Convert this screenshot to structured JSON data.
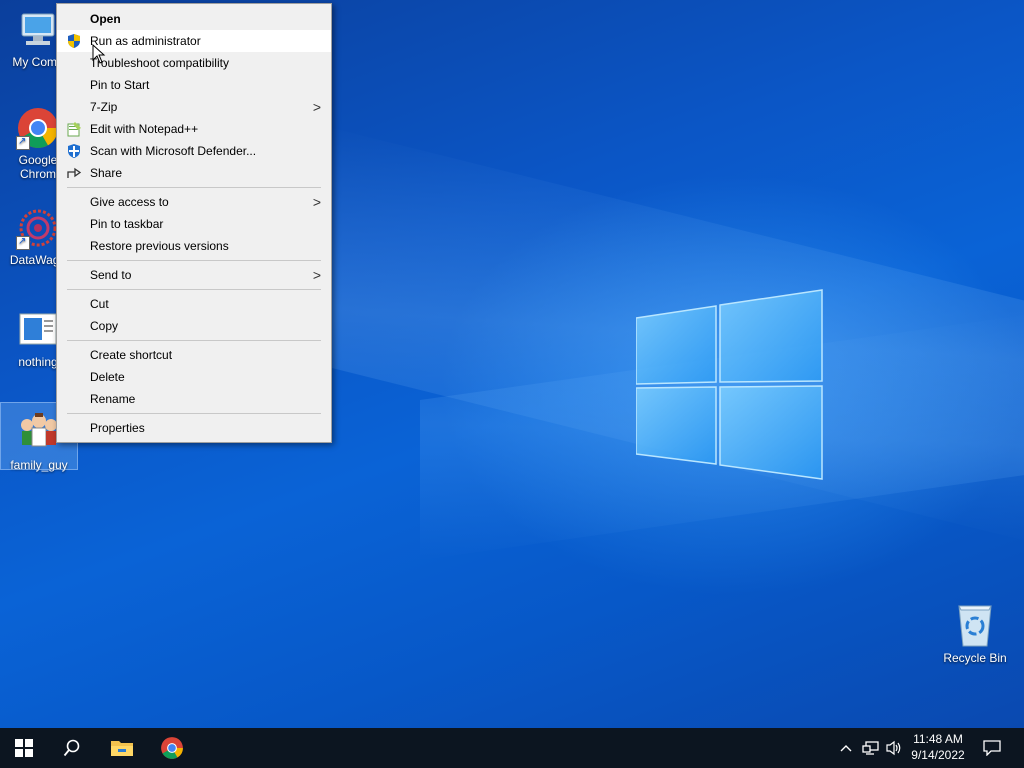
{
  "desktop": {
    "icons": [
      {
        "label": "My Comp",
        "icon": "computer-icon"
      },
      {
        "label": "Google Chrom",
        "icon": "chrome-icon"
      },
      {
        "label": "DataWago",
        "icon": "datawagon-icon"
      },
      {
        "label": "nothing",
        "icon": "document-icon"
      },
      {
        "label": "family_guy",
        "icon": "family-guy-icon"
      }
    ],
    "recycle_bin": {
      "label": "Recycle Bin",
      "icon": "recycle-bin-icon"
    }
  },
  "context_menu": {
    "items": [
      {
        "label": "Open",
        "bold": true
      },
      {
        "label": "Run as administrator",
        "icon": "uac-shield-icon",
        "hovered": true
      },
      {
        "label": "Troubleshoot compatibility"
      },
      {
        "label": "Pin to Start"
      },
      {
        "label": "7-Zip",
        "submenu": true
      },
      {
        "label": "Edit with Notepad++",
        "icon": "notepad-plus-plus-icon"
      },
      {
        "label": "Scan with Microsoft Defender...",
        "icon": "defender-icon"
      },
      {
        "label": "Share",
        "icon": "share-icon"
      },
      {
        "label": "Give access to",
        "submenu": true
      },
      {
        "label": "Pin to taskbar"
      },
      {
        "label": "Restore previous versions"
      },
      {
        "label": "Send to",
        "submenu": true
      },
      {
        "label": "Cut"
      },
      {
        "label": "Copy"
      },
      {
        "label": "Create shortcut"
      },
      {
        "label": "Delete"
      },
      {
        "label": "Rename"
      },
      {
        "label": "Properties"
      }
    ],
    "submenu_arrow": ">"
  },
  "taskbar": {
    "start_icon": "windows-start-icon",
    "search_icon": "search-icon",
    "pinned": [
      {
        "name": "file-explorer",
        "icon": "folder-icon"
      },
      {
        "name": "google-chrome",
        "icon": "chrome-icon"
      }
    ],
    "tray": {
      "chevron": "^",
      "clock_time": "11:48 AM",
      "clock_date": "9/14/2022"
    }
  },
  "colors": {
    "desktop_blue": "#0a5bd0",
    "taskbar": "#0c1520",
    "menu_bg": "#f0f0f0",
    "menu_hover": "#ffffff"
  }
}
